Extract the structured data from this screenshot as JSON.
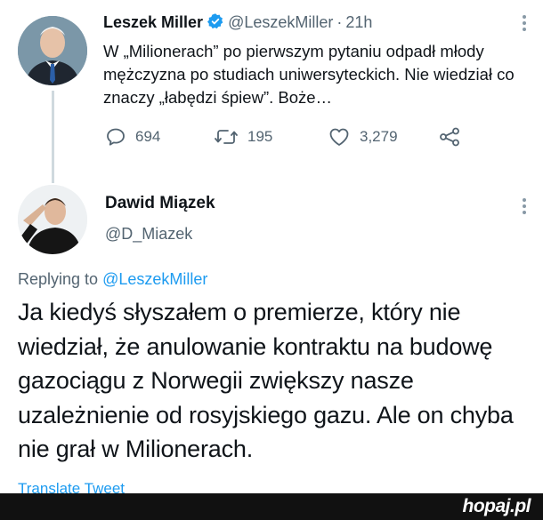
{
  "tweet1": {
    "author_name": "Leszek Miller",
    "handle": "@LeszekMiller",
    "separator": "·",
    "time": "21h",
    "body": "W „Milionerach” po pierwszym pytaniu odpadł młody mężczyzna po studiach uniwersyteckich. Nie wiedział co znaczy „łabędzi śpiew”. Boże…",
    "replies": "694",
    "retweets": "195",
    "likes": "3,279"
  },
  "tweet2": {
    "author_name": "Dawid Miązek",
    "handle": "@D_Miazek",
    "replying_prefix": "Replying to",
    "replying_to": "@LeszekMiller",
    "body": "Ja kiedyś słyszałem o premierze, który nie wiedział, że anulowanie kontraktu na budowę gazociągu z Norwegii zwiększy nasze uzależnienie od rosyjskiego gazu. Ale on chyba nie grał w Milionerach.",
    "translate": "Translate Tweet"
  },
  "watermark": "hopaj.pl",
  "colors": {
    "link": "#1d9bf0",
    "secondary_text": "#536471",
    "primary_text": "#0f1419",
    "verified": "#1d9bf0"
  }
}
